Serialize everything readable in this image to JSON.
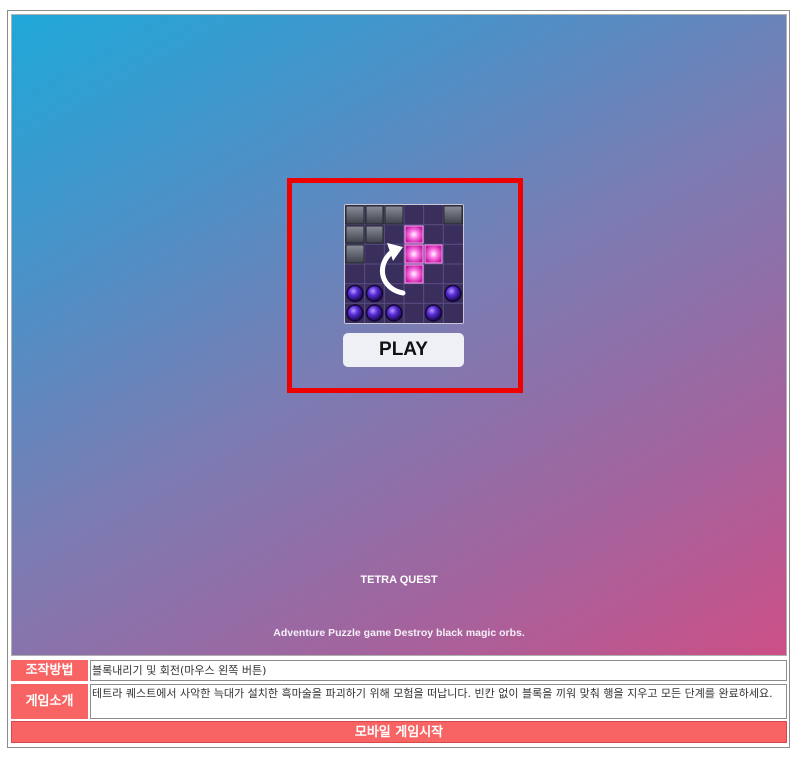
{
  "game": {
    "play_label": "PLAY",
    "title": "TETRA QUEST",
    "description": "Adventure Puzzle game Destroy black magic orbs."
  },
  "info": {
    "controls_label": "조작방법",
    "controls_value": "블록내리기 및 회전(마우스 왼쪽 버튼)",
    "intro_label": "게임소개",
    "intro_value": "테트라 퀘스트에서 사악한 늑대가 설치한 흑마술을 파괴하기 위해 모험을 떠납니다. 빈칸 없이 블록을 끼워 맞춰 행을 지우고 모든 단계를 완료하세요."
  },
  "mobile_start_label": "모바일 게임시작",
  "colors": {
    "accent_red": "#f86464",
    "highlight_border": "#ef0000",
    "gradient_start": "#1fa8d8",
    "gradient_end": "#cc4f87"
  }
}
